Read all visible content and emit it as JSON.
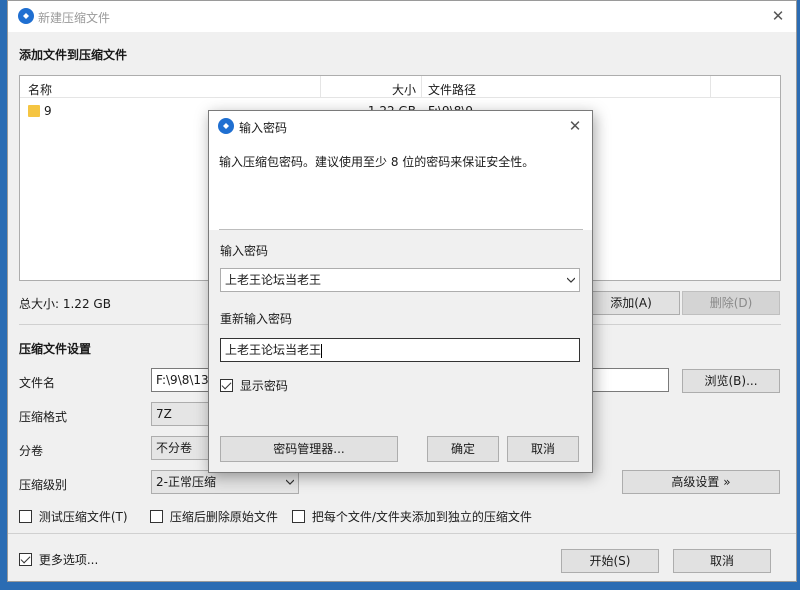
{
  "window": {
    "title": "新建压缩文件",
    "close_icon": "close-icon"
  },
  "files_section": {
    "label": "添加文件到压缩文件",
    "columns": [
      "名称",
      "大小",
      "文件路径"
    ],
    "rows": [
      {
        "name": "9",
        "size": "1.22 GB",
        "path": "F:\\9\\8\\9"
      }
    ]
  },
  "total_size": "总大小: 1.22 GB",
  "add_button": "添加(A)",
  "delete_button": "删除(D)",
  "settings": {
    "label": "压缩文件设置",
    "filename_label": "文件名",
    "filename_value": "F:\\9\\8\\13",
    "browse_button": "浏览(B)...",
    "format_label": "压缩格式",
    "format_value": "7Z",
    "volume_label": "分卷",
    "volume_value": "不分卷",
    "level_label": "压缩级别",
    "level_value": "2-正常压缩",
    "advanced_button": "高级设置 »",
    "options": [
      {
        "label": "测试压缩文件(T)",
        "checked": false
      },
      {
        "label": "压缩后删除原始文件",
        "checked": false
      },
      {
        "label": "把每个文件/文件夹添加到独立的压缩文件",
        "checked": false
      }
    ]
  },
  "more_options": {
    "label": "更多选项...",
    "checked": true
  },
  "start_button": "开始(S)",
  "cancel_button": "取消",
  "dialog": {
    "title": "输入密码",
    "description": "输入压缩包密码。建议使用至少 8 位的密码来保证安全性。",
    "password_label": "输入密码",
    "password_value": "上老王论坛当老王",
    "confirm_label": "重新输入密码",
    "confirm_value": "上老王论坛当老王",
    "show_password": {
      "label": "显示密码",
      "checked": true
    },
    "password_manager_button": "密码管理器...",
    "ok_button": "确定",
    "cancel_button": "取消"
  },
  "colors": {
    "accent": "#1f6fd1",
    "desktop": "#2b6cb3"
  }
}
